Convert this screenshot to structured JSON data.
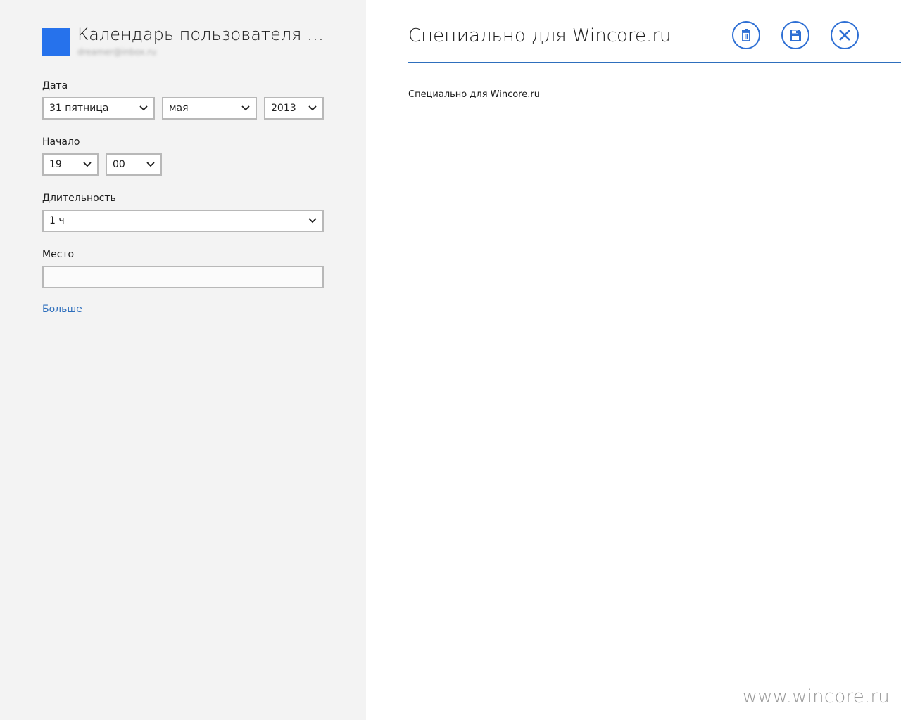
{
  "calendar": {
    "name": "Календарь пользователя M...",
    "email": "dreamer@inbox.ru",
    "color": "#2672ec"
  },
  "form": {
    "date": {
      "label": "Дата",
      "day": "31 пятница",
      "month": "мая",
      "year": "2013"
    },
    "start": {
      "label": "Начало",
      "hour": "19",
      "minute": "00"
    },
    "duration": {
      "label": "Длительность",
      "value": "1 ч"
    },
    "location": {
      "label": "Место",
      "value": ""
    },
    "more_label": "Больше"
  },
  "event": {
    "title": "Специально для Wincore.ru",
    "body": "Специально для Wincore.ru"
  },
  "toolbar": {
    "delete_icon": "trash-icon",
    "save_icon": "save-icon",
    "close_icon": "close-icon",
    "accent": "#2e6fd4"
  },
  "watermark": "www.wincore.ru"
}
